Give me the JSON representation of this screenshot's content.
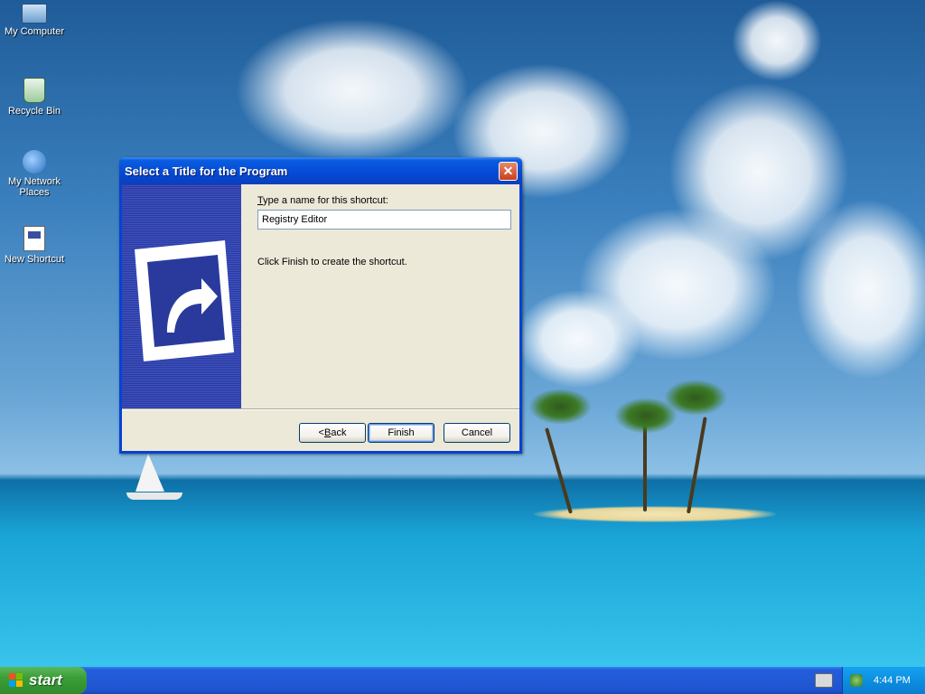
{
  "desktop": {
    "icons": [
      {
        "label": "My Computer",
        "icon": "computer-icon"
      },
      {
        "label": "Recycle Bin",
        "icon": "recycle-bin-icon"
      },
      {
        "label": "My Network Places",
        "icon": "network-places-icon"
      },
      {
        "label": "New Shortcut",
        "icon": "shortcut-file-icon"
      }
    ]
  },
  "dialog": {
    "title": "Select a Title for the Program",
    "prompt_access_key": "T",
    "prompt_rest": "ype a name for this shortcut:",
    "name_value": "Registry Editor",
    "info": "Click Finish to create the shortcut.",
    "back_prefix": "< ",
    "back_access_key": "B",
    "back_rest": "ack",
    "finish_label": "Finish",
    "cancel_label": "Cancel",
    "accent": "#0842d1",
    "side_panel_color": "#2a3a9c"
  },
  "taskbar": {
    "start_label": "start",
    "clock": "4:44 PM",
    "color": "#245edc",
    "start_color": "#3b9f37"
  }
}
